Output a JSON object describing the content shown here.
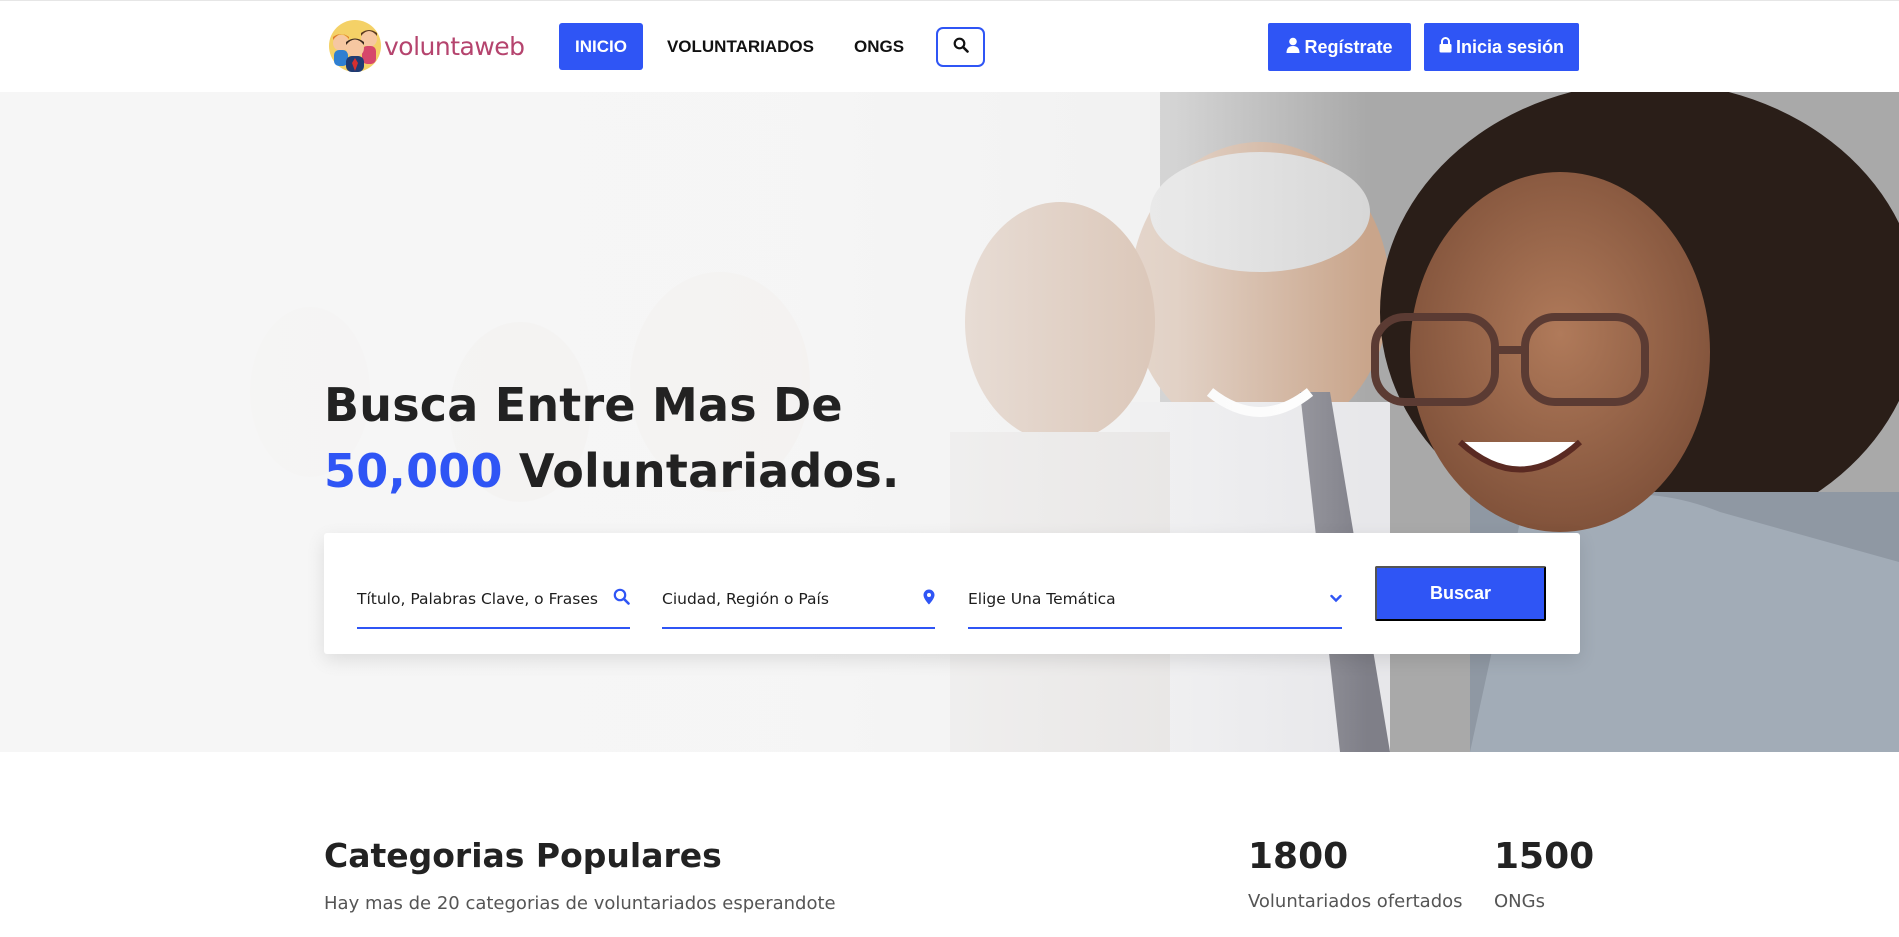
{
  "header": {
    "logo_text": "voluntaweb",
    "nav": [
      {
        "label": "INICIO",
        "active": true
      },
      {
        "label": "VOLUNTARIADOS",
        "active": false
      },
      {
        "label": "ONGS",
        "active": false
      }
    ],
    "register_label": "Regístrate",
    "login_label": "Inicia sesión"
  },
  "hero": {
    "title_line1": "Busca Entre Mas De",
    "title_number": "50,000",
    "title_rest": " Voluntariados.",
    "search": {
      "keywords_placeholder": "Título, Palabras Clave, o Frases",
      "location_placeholder": "Ciudad, Región o País",
      "theme_selected": "Elige Una Temática",
      "submit_label": "Buscar"
    }
  },
  "categories": {
    "title": "Categorias Populares",
    "subtitle": "Hay mas de 20 categorias de voluntariados esperandote"
  },
  "stats": [
    {
      "value": "1800",
      "label": "Voluntariados ofertados"
    },
    {
      "value": "1500",
      "label": "ONGs"
    }
  ],
  "colors": {
    "accent": "#2f55f5",
    "logo": "#b5446e",
    "text": "#222222"
  },
  "icons": {
    "search_button": "search-icon",
    "register": "user-icon",
    "login": "lock-icon",
    "keywords": "search-icon",
    "location": "map-pin-icon",
    "theme": "chevron-down-icon"
  }
}
